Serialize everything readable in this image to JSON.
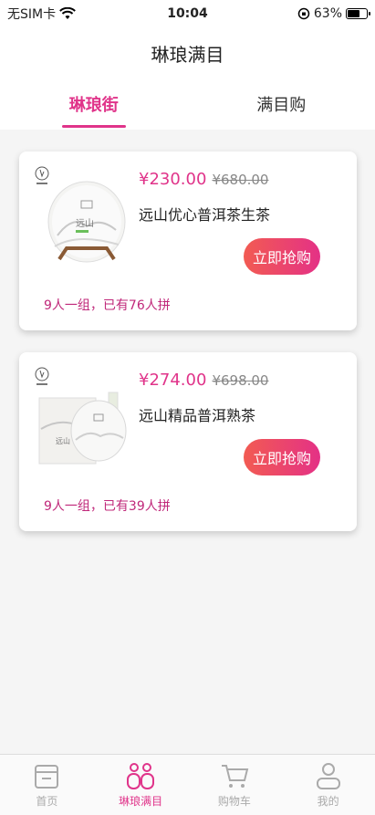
{
  "status_bar": {
    "carrier": "无SIM卡",
    "time": "10:04",
    "battery": "63%",
    "battery_level": 0.63
  },
  "nav": {
    "title": "琳琅满目"
  },
  "tabs": [
    {
      "label": "琳琅街",
      "active": true
    },
    {
      "label": "满目购",
      "active": false
    }
  ],
  "products": [
    {
      "price": "¥230.00",
      "original_price": "¥680.00",
      "name": "远山优心普洱茶生茶",
      "buy_label": "立即抢购",
      "group_info": "9人一组，已有76人拼"
    },
    {
      "price": "¥274.00",
      "original_price": "¥698.00",
      "name": "远山精品普洱熟茶",
      "buy_label": "立即抢购",
      "group_info": "9人一组，已有39人拼"
    }
  ],
  "tab_bar": [
    {
      "label": "首页",
      "icon": "home-icon",
      "active": false
    },
    {
      "label": "琳琅满目",
      "icon": "group-icon",
      "active": true
    },
    {
      "label": "购物车",
      "icon": "cart-icon",
      "active": false
    },
    {
      "label": "我的",
      "icon": "profile-icon",
      "active": false
    }
  ],
  "colors": {
    "accent": "#e0348a",
    "button_gradient_start": "#f25b52",
    "button_gradient_end": "#e43186"
  }
}
